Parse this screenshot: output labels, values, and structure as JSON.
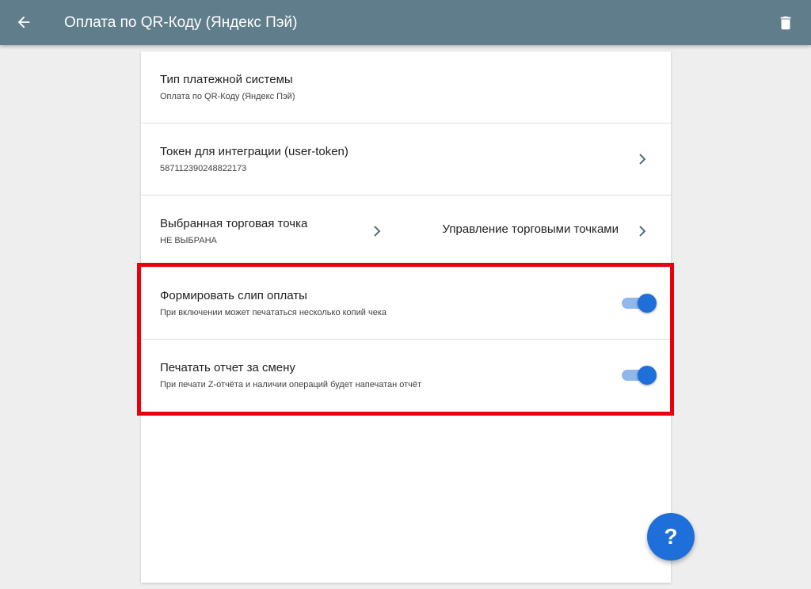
{
  "appbar": {
    "title": "Оплата по QR-Коду (Яндекс Пэй)",
    "back_icon": "arrow-left-icon",
    "delete_icon": "trash-icon"
  },
  "settings": {
    "payment_system": {
      "label": "Тип платежной системы",
      "value": "Оплата по QR-Коду (Яндекс Пэй)"
    },
    "token": {
      "label": "Токен для интеграции (user-token)",
      "value": "587112390248822173"
    },
    "outlet": {
      "label": "Выбранная торговая точка",
      "value": "НЕ ВЫБРАНА",
      "manage_label": "Управление торговыми точками"
    },
    "payment_slip": {
      "label": "Формировать слип оплаты",
      "description": "При включении может печататься несколько копий чека",
      "enabled": true
    },
    "shift_report": {
      "label": "Печатать отчет за смену",
      "description": "При печати Z-отчёта и наличии операций будет напечатан отчёт",
      "enabled": true
    }
  },
  "help_button": {
    "label": "?"
  },
  "colors": {
    "appbar": "#607d8b",
    "accent": "#1e6fd9",
    "highlight": "#e8000d"
  }
}
